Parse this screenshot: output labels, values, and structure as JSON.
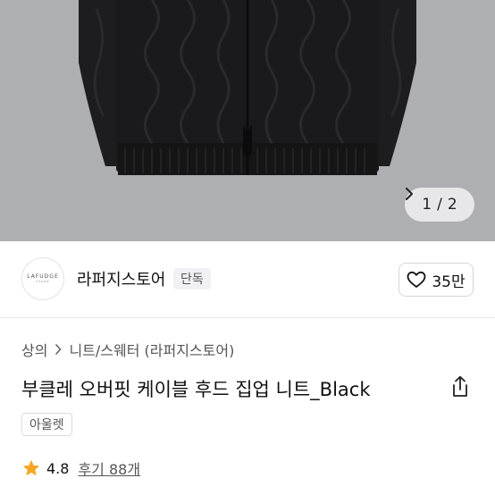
{
  "hero": {
    "image_subject": "black cable-knit zip-up hoodie",
    "page_current": "1",
    "page_separator": "/",
    "page_total": "2",
    "icon": "chevron-right-icon",
    "indicator_bg": "#ebeced"
  },
  "seller": {
    "logo_brand": "LAFUDGE",
    "logo_sub": "STORE",
    "name": "라퍼지스토어",
    "badge": "단독",
    "like_count": "35만",
    "like_icon": "heart-outline-icon"
  },
  "breadcrumb": {
    "items": [
      "상의",
      "니트/스웨터 (라퍼지스토어)"
    ],
    "separator_icon": "chevron-right-icon"
  },
  "product": {
    "title": "부클레 오버핏 케이블 후드 집업 니트_Black",
    "share_icon": "share-icon",
    "tag": "아울렛"
  },
  "rating": {
    "score": "4.8",
    "reviews_label": "후기 88개",
    "star_icon": "star-icon",
    "star_color": "#f5a623"
  }
}
